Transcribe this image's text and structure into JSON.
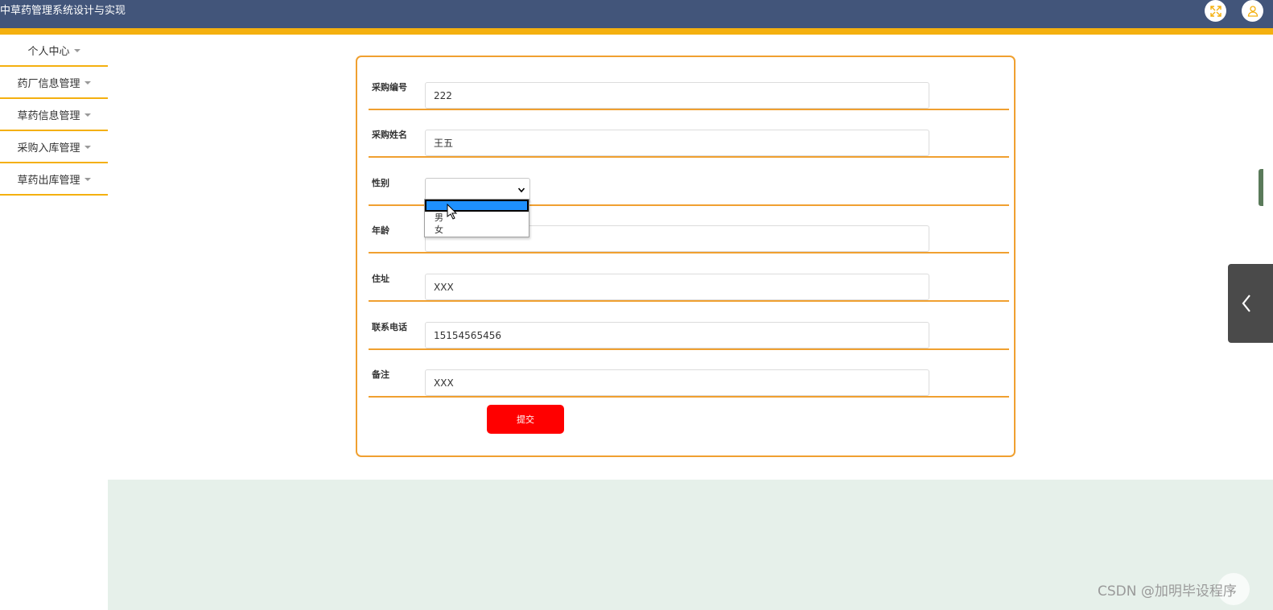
{
  "header": {
    "title": "中草药管理系统设计与实现",
    "fullscreen_icon": "fullscreen-icon",
    "user_icon": "user-icon"
  },
  "sidebar": {
    "items": [
      {
        "label": "个人中心"
      },
      {
        "label": "药厂信息管理"
      },
      {
        "label": "草药信息管理"
      },
      {
        "label": "采购入库管理"
      },
      {
        "label": "草药出库管理"
      }
    ]
  },
  "form": {
    "fields": [
      {
        "label": "采购编号",
        "value": "222"
      },
      {
        "label": "采购姓名",
        "value": "王五"
      },
      {
        "label": "性别",
        "value": ""
      },
      {
        "label": "年龄",
        "value": ""
      },
      {
        "label": "住址",
        "value": "XXX"
      },
      {
        "label": "联系电话",
        "value": "15154565456"
      },
      {
        "label": "备注",
        "value": "XXX"
      }
    ],
    "gender_options": [
      "",
      "男",
      "女"
    ],
    "submit_label": "提交"
  },
  "watermark": "CSDN @加明毕设程序",
  "colors": {
    "header_bg": "#42557a",
    "accent": "#f4b00f",
    "card_border": "#f0a030",
    "submit_bg": "#ff0000",
    "bottom_bg": "#e6f0ea"
  }
}
